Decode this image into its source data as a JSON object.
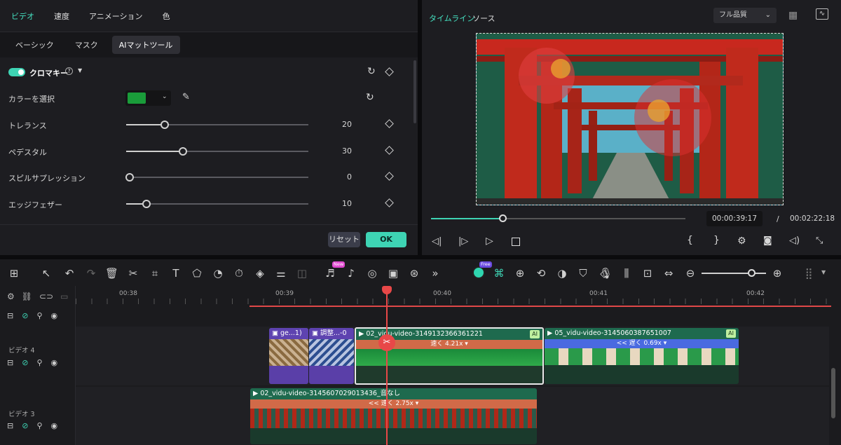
{
  "left_panel": {
    "tabs": [
      "ビデオ",
      "速度",
      "アニメーション",
      "色"
    ],
    "subtabs": [
      "ベーシック",
      "マスク",
      "AIマットツール"
    ],
    "chroma_key_label": "クロマキー",
    "color_select_label": "カラーを選択",
    "key_color": "#1a9c3a",
    "sliders": [
      {
        "label": "トレランス",
        "value": "20",
        "fraction": 0.21
      },
      {
        "label": "ペデスタル",
        "value": "30",
        "fraction": 0.31
      },
      {
        "label": "スピルサプレッション",
        "value": "0",
        "fraction": 0.0
      },
      {
        "label": "エッジフェザー",
        "value": "10",
        "fraction": 0.11
      }
    ],
    "reset_label": "リセット",
    "ok_label": "OK"
  },
  "right_panel": {
    "tabs": [
      "タイムライン",
      "ソース"
    ],
    "quality": "フル品質",
    "current_time": "00:00:39:17",
    "separator": "/",
    "total_time": "00:02:22:18",
    "progress_fraction": 0.28
  },
  "timeline": {
    "badge_new": "New",
    "badge_free": "Free",
    "ruler": [
      "00:38",
      "00:39",
      "00:40",
      "00:41",
      "00:42"
    ],
    "tracks": [
      {
        "label": "ビデオ 4"
      },
      {
        "label": "ビデオ 3"
      }
    ],
    "clips": {
      "c1": "ge...1)",
      "c2": "調整...-0",
      "c3": "02_vidu-video-3149132366361221",
      "c3_speed": "速く 4.21x",
      "c4": "05_vidu-video-3145060387651007",
      "c4_speed": "<< 遅く 0.69x",
      "c5": "02_vidu-video-3145607029013436_音なし",
      "c5_speed": "<< 速く 2.75x",
      "ai": "AI"
    }
  }
}
